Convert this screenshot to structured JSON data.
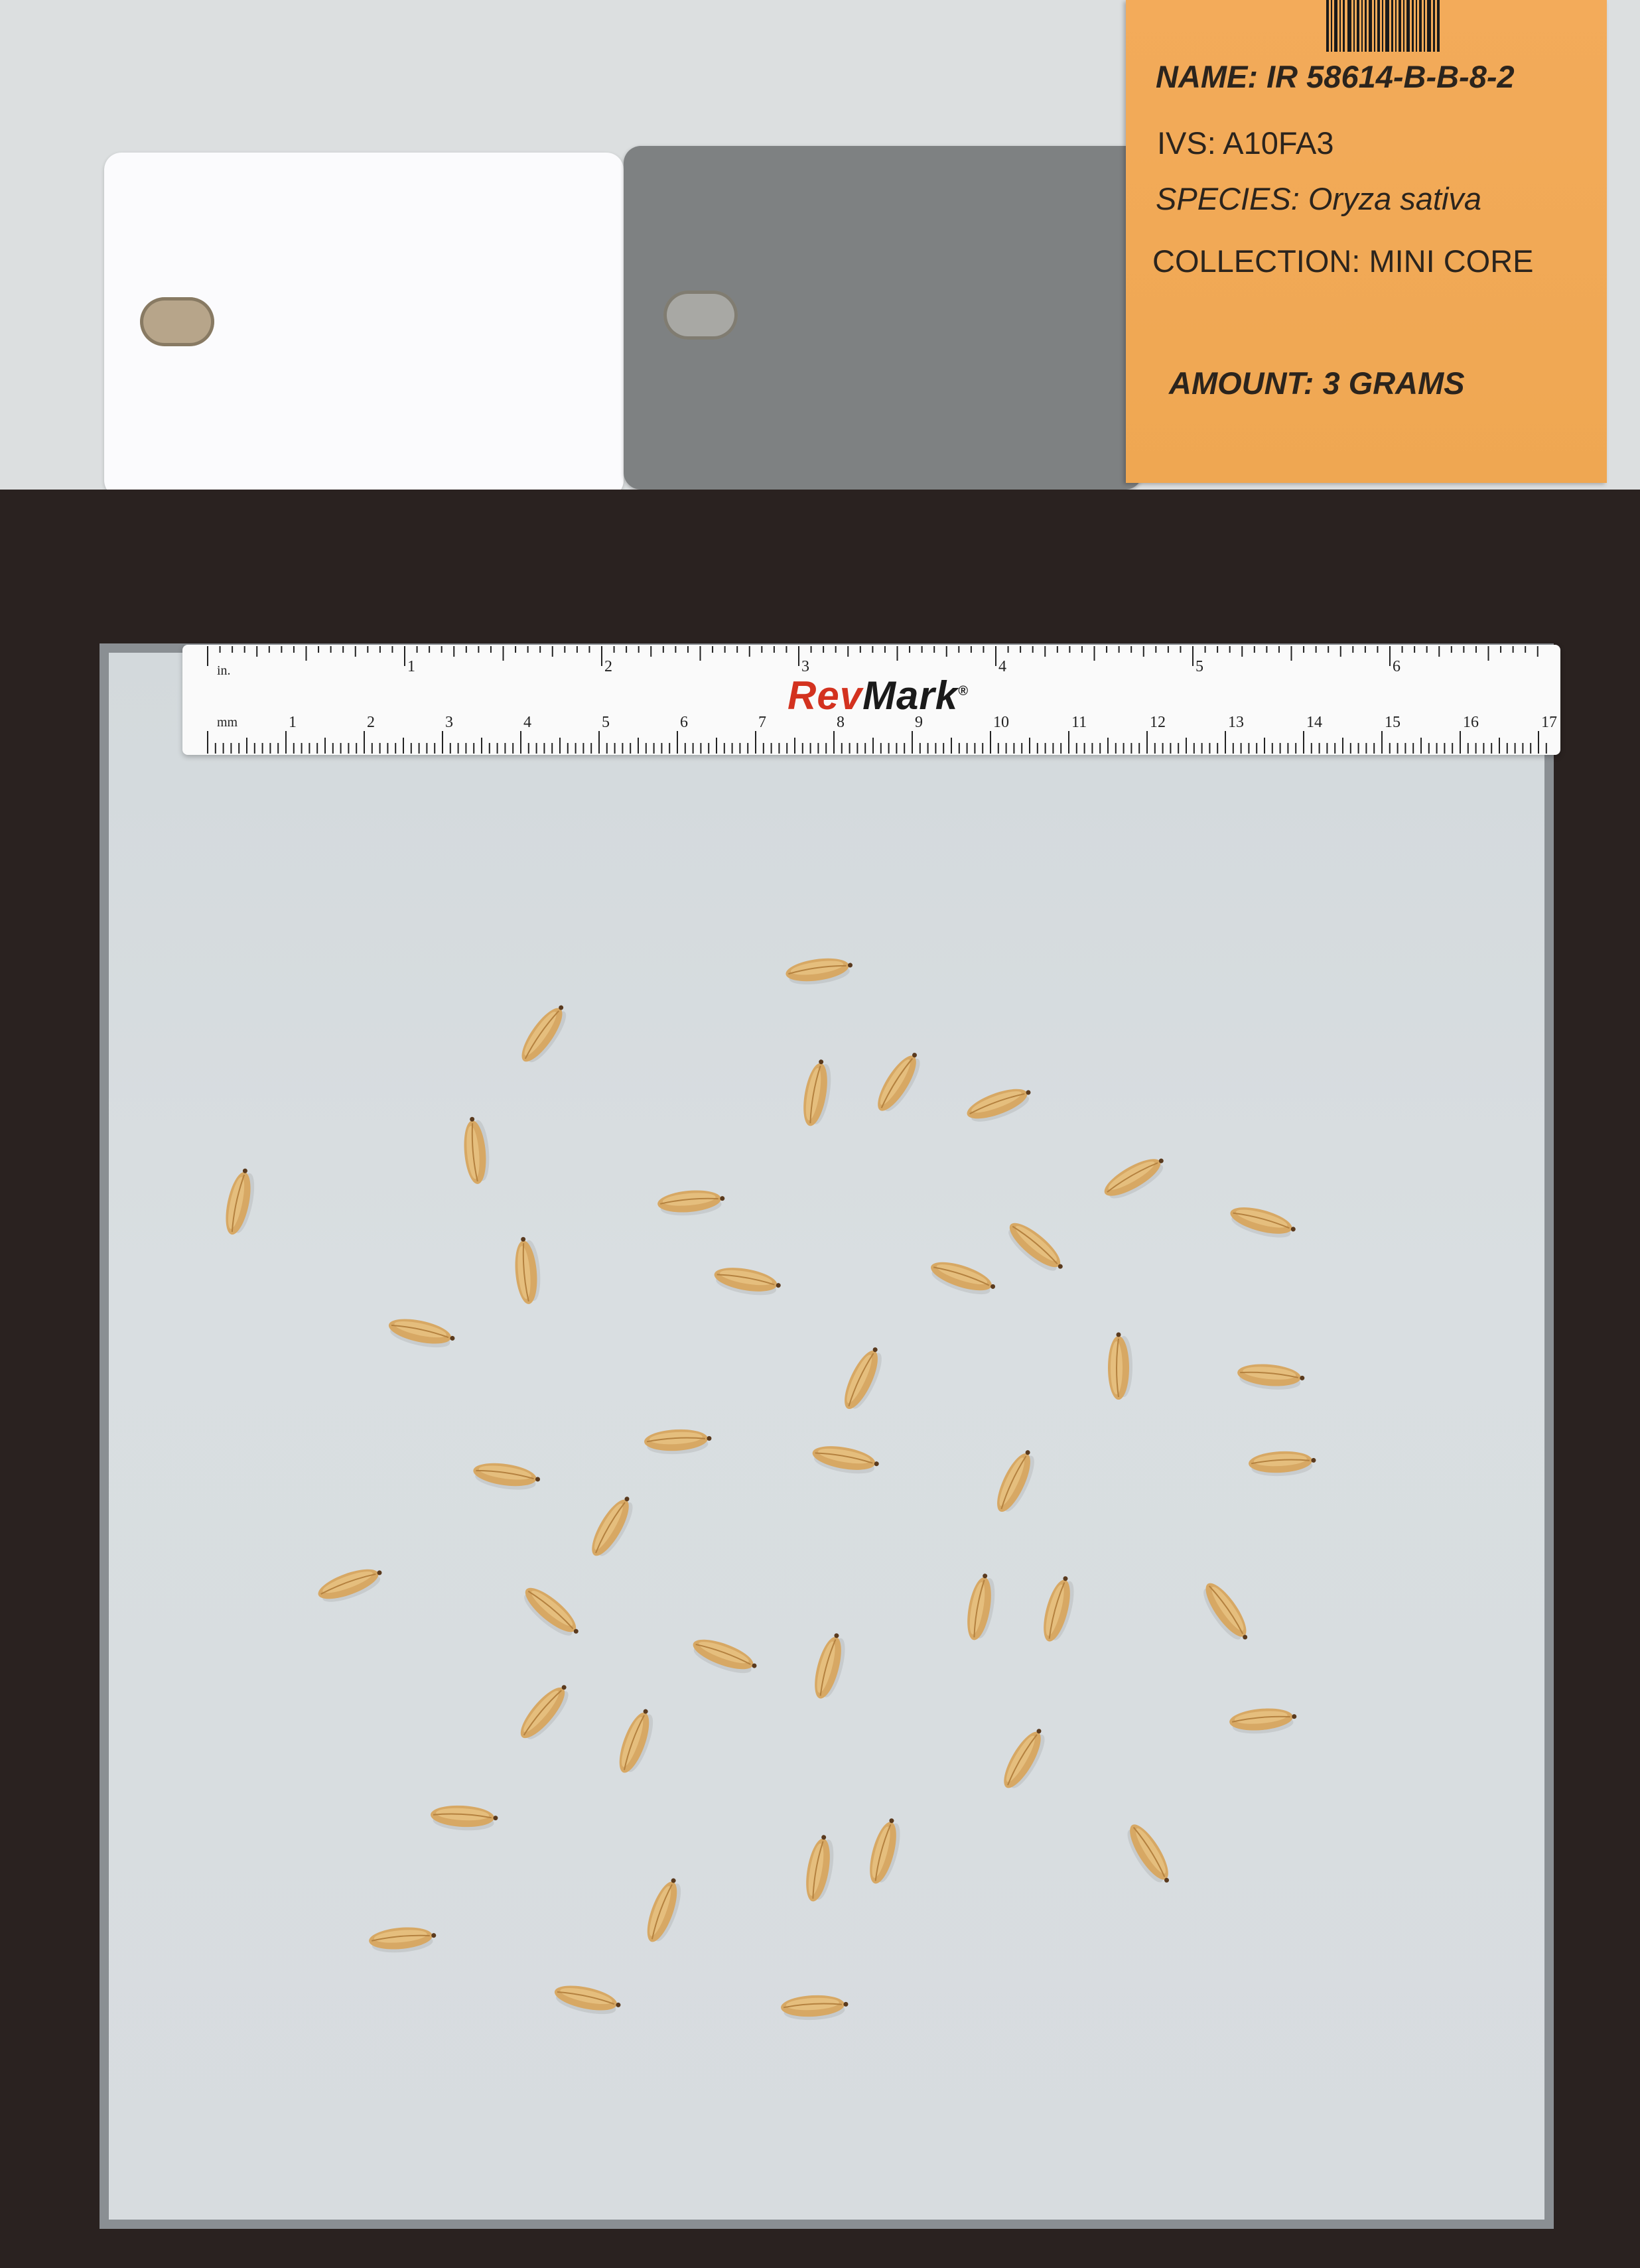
{
  "envelope": {
    "name_label": "NAME:",
    "name_value": "IR 58614-B-B-8-2",
    "ivs_label": "IVS:",
    "ivs_value": "A10FA3",
    "species_label": "SPECIES:",
    "species_value": "Oryza sativa",
    "collection_label": "COLLECTION:",
    "collection_value": "MINI CORE",
    "amount_label": "AMOUNT:",
    "amount_value": "3 GRAMS"
  },
  "ruler": {
    "brand_red": "Rev",
    "brand_black": "Mark",
    "brand_mark": "®",
    "inch_unit": "in.",
    "mm_unit": "mm",
    "inch_labels": [
      "1",
      "2",
      "3",
      "4",
      "5",
      "6"
    ],
    "cm_labels": [
      "1",
      "2",
      "3",
      "4",
      "5",
      "6",
      "7",
      "8",
      "9",
      "10",
      "11",
      "12",
      "13",
      "14",
      "15",
      "16",
      "17"
    ]
  },
  "colors": {
    "envelope": "#f1a955",
    "frame": "#2a2220",
    "tray": "#d9dee1",
    "grain": "#d9ac6a",
    "brand_red": "#d3321f"
  }
}
